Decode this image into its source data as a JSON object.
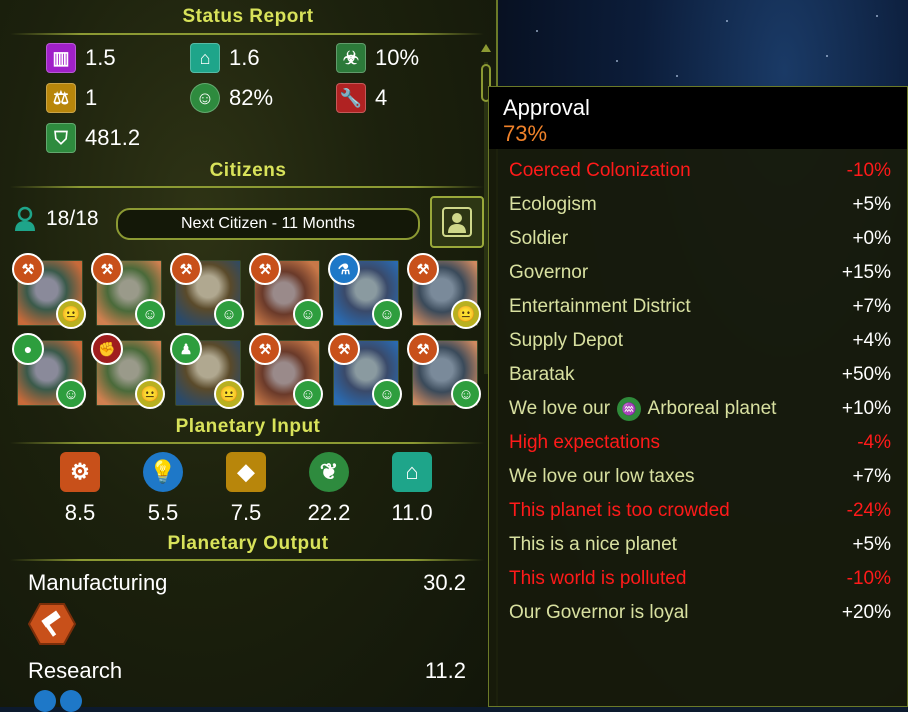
{
  "status_report": {
    "title": "Status Report",
    "stats": [
      {
        "icon": "production-pillar-icon",
        "value": "1.5",
        "color": "#a020c8"
      },
      {
        "icon": "infrastructure-icon",
        "value": "1.6",
        "color": "#1ea58a"
      },
      {
        "icon": "pollution-biohazard-icon",
        "value": "10%",
        "color": "#2c7a3a"
      },
      {
        "icon": "justice-scales-icon",
        "value": "1",
        "color": "#b8860b"
      },
      {
        "icon": "happiness-face-icon",
        "value": "82%",
        "color": "#2e8b3e"
      },
      {
        "icon": "maintenance-wrench-icon",
        "value": "4",
        "color": "#b02222"
      },
      {
        "icon": "defense-shield-icon",
        "value": "481.2",
        "color": "#2e8b3e"
      }
    ]
  },
  "citizens": {
    "title": "Citizens",
    "population": "18/18",
    "next_citizen": "Next Citizen - 11 Months",
    "list": [
      {
        "job": "hammer-icon",
        "job_color": "#c8501a",
        "mood": "neutral-face-icon",
        "mood_color": "#b8b020"
      },
      {
        "job": "hammer-icon",
        "job_color": "#c8501a",
        "mood": "happy-face-icon",
        "mood_color": "#2e9e3e"
      },
      {
        "job": "hammer-icon",
        "job_color": "#c8501a",
        "mood": "happy-face-icon",
        "mood_color": "#2e9e3e"
      },
      {
        "job": "hammer-icon",
        "job_color": "#c8501a",
        "mood": "happy-face-icon",
        "mood_color": "#2e9e3e"
      },
      {
        "job": "flask-icon",
        "job_color": "#1e78c8",
        "mood": "happy-face-icon",
        "mood_color": "#2e9e3e"
      },
      {
        "job": "hammer-icon",
        "job_color": "#c8501a",
        "mood": "neutral-face-icon",
        "mood_color": "#b8b020"
      },
      {
        "job": "apple-icon",
        "job_color": "#2e9e3e",
        "mood": "happy-face-icon",
        "mood_color": "#2e9e3e"
      },
      {
        "job": "fist-icon",
        "job_color": "#a01e1e",
        "mood": "neutral-face-icon",
        "mood_color": "#b8b020"
      },
      {
        "job": "person-icon",
        "job_color": "#2e9e3e",
        "mood": "neutral-face-icon",
        "mood_color": "#b8b020"
      },
      {
        "job": "hammer-icon",
        "job_color": "#c8501a",
        "mood": "happy-face-icon",
        "mood_color": "#2e9e3e"
      },
      {
        "job": "hammer-icon",
        "job_color": "#c8501a",
        "mood": "happy-face-icon",
        "mood_color": "#2e9e3e"
      },
      {
        "job": "hammer-icon",
        "job_color": "#c8501a",
        "mood": "happy-face-icon",
        "mood_color": "#2e9e3e"
      }
    ]
  },
  "planetary_input": {
    "title": "Planetary Input",
    "items": [
      {
        "icon": "industry-gear-icon",
        "value": "8.5",
        "color": "#c8501a"
      },
      {
        "icon": "science-bulb-icon",
        "value": "5.5",
        "color": "#1e78c8"
      },
      {
        "icon": "dust-gem-icon",
        "value": "7.5",
        "color": "#b8860b"
      },
      {
        "icon": "food-leaf-icon",
        "value": "22.2",
        "color": "#2e8b3e"
      },
      {
        "icon": "infrastructure-icon",
        "value": "11.0",
        "color": "#1ea58a"
      }
    ]
  },
  "planetary_output": {
    "title": "Planetary Output",
    "rows": [
      {
        "label": "Manufacturing",
        "value": "30.2"
      },
      {
        "label": "Research",
        "value": "11.2"
      }
    ]
  },
  "tooltip": {
    "title": "Approval",
    "value": "73%",
    "rows": [
      {
        "label": "Coerced Colonization",
        "amount": "-10%",
        "negative": true
      },
      {
        "label": "Ecologism",
        "amount": "+5%",
        "negative": false
      },
      {
        "label": "Soldier",
        "amount": "+0%",
        "negative": false
      },
      {
        "label": "Governor",
        "amount": "+15%",
        "negative": false
      },
      {
        "label": "Entertainment District",
        "amount": "+7%",
        "negative": false
      },
      {
        "label": "Supply Depot",
        "amount": "+4%",
        "negative": false
      },
      {
        "label": "Baratak",
        "amount": "+50%",
        "negative": false
      },
      {
        "label_pre": "We love our",
        "label_icon": "arboreal-planet-icon",
        "label_post": "Arboreal planet",
        "amount": "+10%",
        "negative": false
      },
      {
        "label": "High expectations",
        "amount": "-4%",
        "negative": true
      },
      {
        "label": "We love our low taxes",
        "amount": "+7%",
        "negative": false
      },
      {
        "label": "This planet is too crowded",
        "amount": "-24%",
        "negative": true
      },
      {
        "label": "This is a nice planet",
        "amount": "+5%",
        "negative": false
      },
      {
        "label": "This world is polluted",
        "amount": "-10%",
        "negative": true
      },
      {
        "label": "Our Governor is loyal",
        "amount": "+20%",
        "negative": false
      }
    ]
  }
}
